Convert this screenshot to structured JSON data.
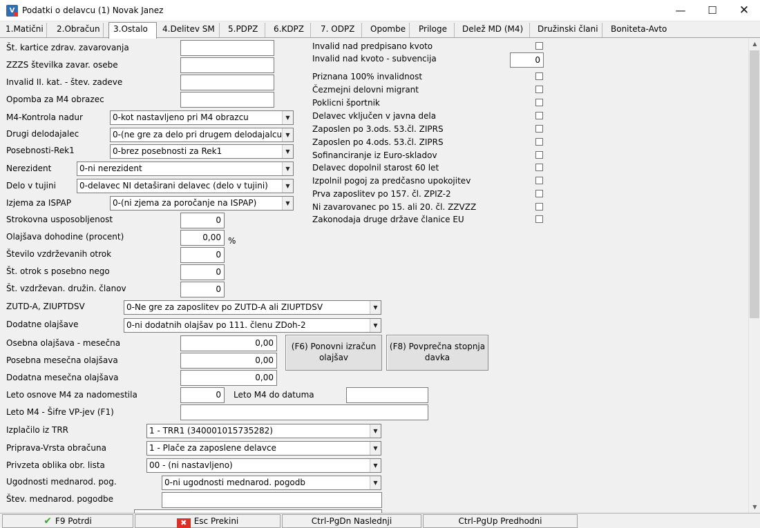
{
  "window": {
    "icon_label": "V",
    "title": "Podatki o delavcu (1) Novak Janez"
  },
  "tabs": [
    {
      "label": "1.Matični"
    },
    {
      "label": "2.Obračun"
    },
    {
      "label": "3.Ostalo"
    },
    {
      "label": "4.Delitev SM"
    },
    {
      "label": "5.PDPZ"
    },
    {
      "label": "6.KDPZ"
    },
    {
      "label": "7. ODPZ"
    },
    {
      "label": "Opombe"
    },
    {
      "label": "Priloge"
    },
    {
      "label": "Delež MD (M4)"
    },
    {
      "label": "Družinski člani"
    },
    {
      "label": "Boniteta-Avto"
    }
  ],
  "active_tab": "3.Ostalo",
  "fields": {
    "kartica_zzzs": {
      "label": "Št. kartice zdrav. zavarovanja",
      "value": ""
    },
    "zzzs_stevilka": {
      "label": "ZZZS številka zavar. osebe",
      "value": ""
    },
    "invalid_zadeva": {
      "label": "Invalid II. kat. - štev. zadeve",
      "value": ""
    },
    "opomba_m4": {
      "label": "Opomba za M4 obrazec",
      "value": ""
    },
    "strokovna": {
      "label": "Strokovna usposobljenost",
      "value": "0"
    },
    "olajsava_proc": {
      "label": "Olajšava dohodine (procent)",
      "value": "0,00",
      "unit": "%"
    },
    "vzdrz_otrok": {
      "label": "Število vzdrževanih otrok",
      "value": "0"
    },
    "otrok_nego": {
      "label": "Št. otrok s posebno nego",
      "value": "0"
    },
    "druzin_clanov": {
      "label": "Št. vzdrževan. družin. članov",
      "value": "0"
    },
    "osebna_olajsava": {
      "label": "Osebna olajšava - mesečna",
      "value": "0,00"
    },
    "posebna_olajsava": {
      "label": "Posebna mesečna olajšava",
      "value": "0,00"
    },
    "dodatna_olajsava": {
      "label": "Dodatna mesečna olajšava",
      "value": "0,00"
    },
    "leto_osnove_m4": {
      "label": "Leto osnove M4 za nadomestila",
      "value": "0"
    },
    "leto_m4_datum": {
      "label": "Leto M4 do datuma",
      "value": ""
    },
    "leto_m4_sifre": {
      "label": "Leto M4 - Šifre VP-jev (F1)",
      "value": ""
    },
    "stev_pogodbe": {
      "label": "Štev. mednarod. pogodbe",
      "value": ""
    }
  },
  "dropdowns": {
    "m4_kontrola": {
      "label": "M4-Kontrola nadur",
      "value": "0-kot nastavljeno pri M4 obrazcu"
    },
    "drugi_delodajalec": {
      "label": "Drugi delodajalec",
      "value": "0-(ne gre za delo pri drugem delodajalcu)"
    },
    "posebnosti_rek1": {
      "label": "Posebnosti-Rek1",
      "value": "0-brez posebnosti za Rek1"
    },
    "nerezident": {
      "label": "Nerezident",
      "value": "0-ni nerezident"
    },
    "delo_tujini": {
      "label": "Delo v tujini",
      "value": "0-delavec NI detaširani delavec (delo v tujini)"
    },
    "izjema_ispap": {
      "label": "Izjema za ISPAP",
      "value": "0-(ni zjema za poročanje na ISPAP)"
    },
    "zutd": {
      "label": "ZUTD-A, ZIUPTDSV",
      "value": "0-Ne gre za zaposlitev po ZUTD-A ali ZIUPTDSV"
    },
    "dodatne_olajsave": {
      "label": "Dodatne olajšave",
      "value": "0-ni dodatnih olajšav po 111. členu ZDoh-2"
    },
    "izplacilo_trr": {
      "label": "Izplačilo iz TRR",
      "value": "1 - TRR1 (340001015735282)"
    },
    "priprava_vrsta": {
      "label": "Priprava-Vrsta obračuna",
      "value": "1 - Plače za zaposlene delavce"
    },
    "privzeta_oblika": {
      "label": "Privzeta oblika obr. lista",
      "value": "00 - (ni nastavljeno)"
    },
    "ugodnosti": {
      "label": "Ugodnosti mednarod. pog.",
      "value": "0-ni ugodnosti mednarod. pogodb"
    }
  },
  "right_panel": {
    "invalid_nad_kvoto": {
      "label": "Invalid nad predpisano kvoto",
      "checked": false
    },
    "subvencija": {
      "label": "Invalid nad kvoto - subvencija",
      "value": "0"
    },
    "checkboxes": [
      {
        "label": "Priznana 100% invalidnost",
        "checked": false
      },
      {
        "label": "Čezmejni delovni migrant",
        "checked": false
      },
      {
        "label": "Poklicni športnik",
        "checked": false
      },
      {
        "label": "Delavec vključen v javna dela",
        "checked": false
      },
      {
        "label": "Zaposlen po 3.ods. 53.čl. ZIPRS",
        "checked": false
      },
      {
        "label": "Zaposlen po 4.ods. 53.čl. ZIPRS",
        "checked": false
      },
      {
        "label": "Sofinanciranje iz Euro-skladov",
        "checked": false
      },
      {
        "label": "Delavec dopolnil starost 60 let",
        "checked": false
      },
      {
        "label": "Izpolnil pogoj za predčasno upokojitev",
        "checked": false
      },
      {
        "label": "Prva zaposlitev po 157. čl. ZPIZ-2",
        "checked": false
      },
      {
        "label": "Ni zavarovanec po 15. ali 20. čl. ZZVZZ",
        "checked": false
      },
      {
        "label": "Zakonodaja druge države članice EU",
        "checked": false
      }
    ]
  },
  "buttons": {
    "f6_line1": "(F6) Ponovni izračun",
    "f6_line2": "olajšav",
    "f8_line1": "(F8) Povprečna stopnja",
    "f8_line2": "davka"
  },
  "footer": {
    "potrdi": "F9 Potrdi",
    "prekini": "Esc Prekini",
    "naslednji": "Ctrl-PgDn  Naslednji",
    "predhodni": "Ctrl-PgUp  Predhodni"
  },
  "icons": {
    "app": "app-logo-icon",
    "minimize": "minimize-icon",
    "maximize": "maximize-icon",
    "close": "close-icon",
    "confirm": "checkmark-icon",
    "cancel": "cancel-x-icon",
    "dropdown": "chevron-down-icon"
  },
  "colors": {
    "accent_app": "#2f6fb8",
    "confirm_green": "#3aa830",
    "cancel_red": "#d9302a"
  }
}
